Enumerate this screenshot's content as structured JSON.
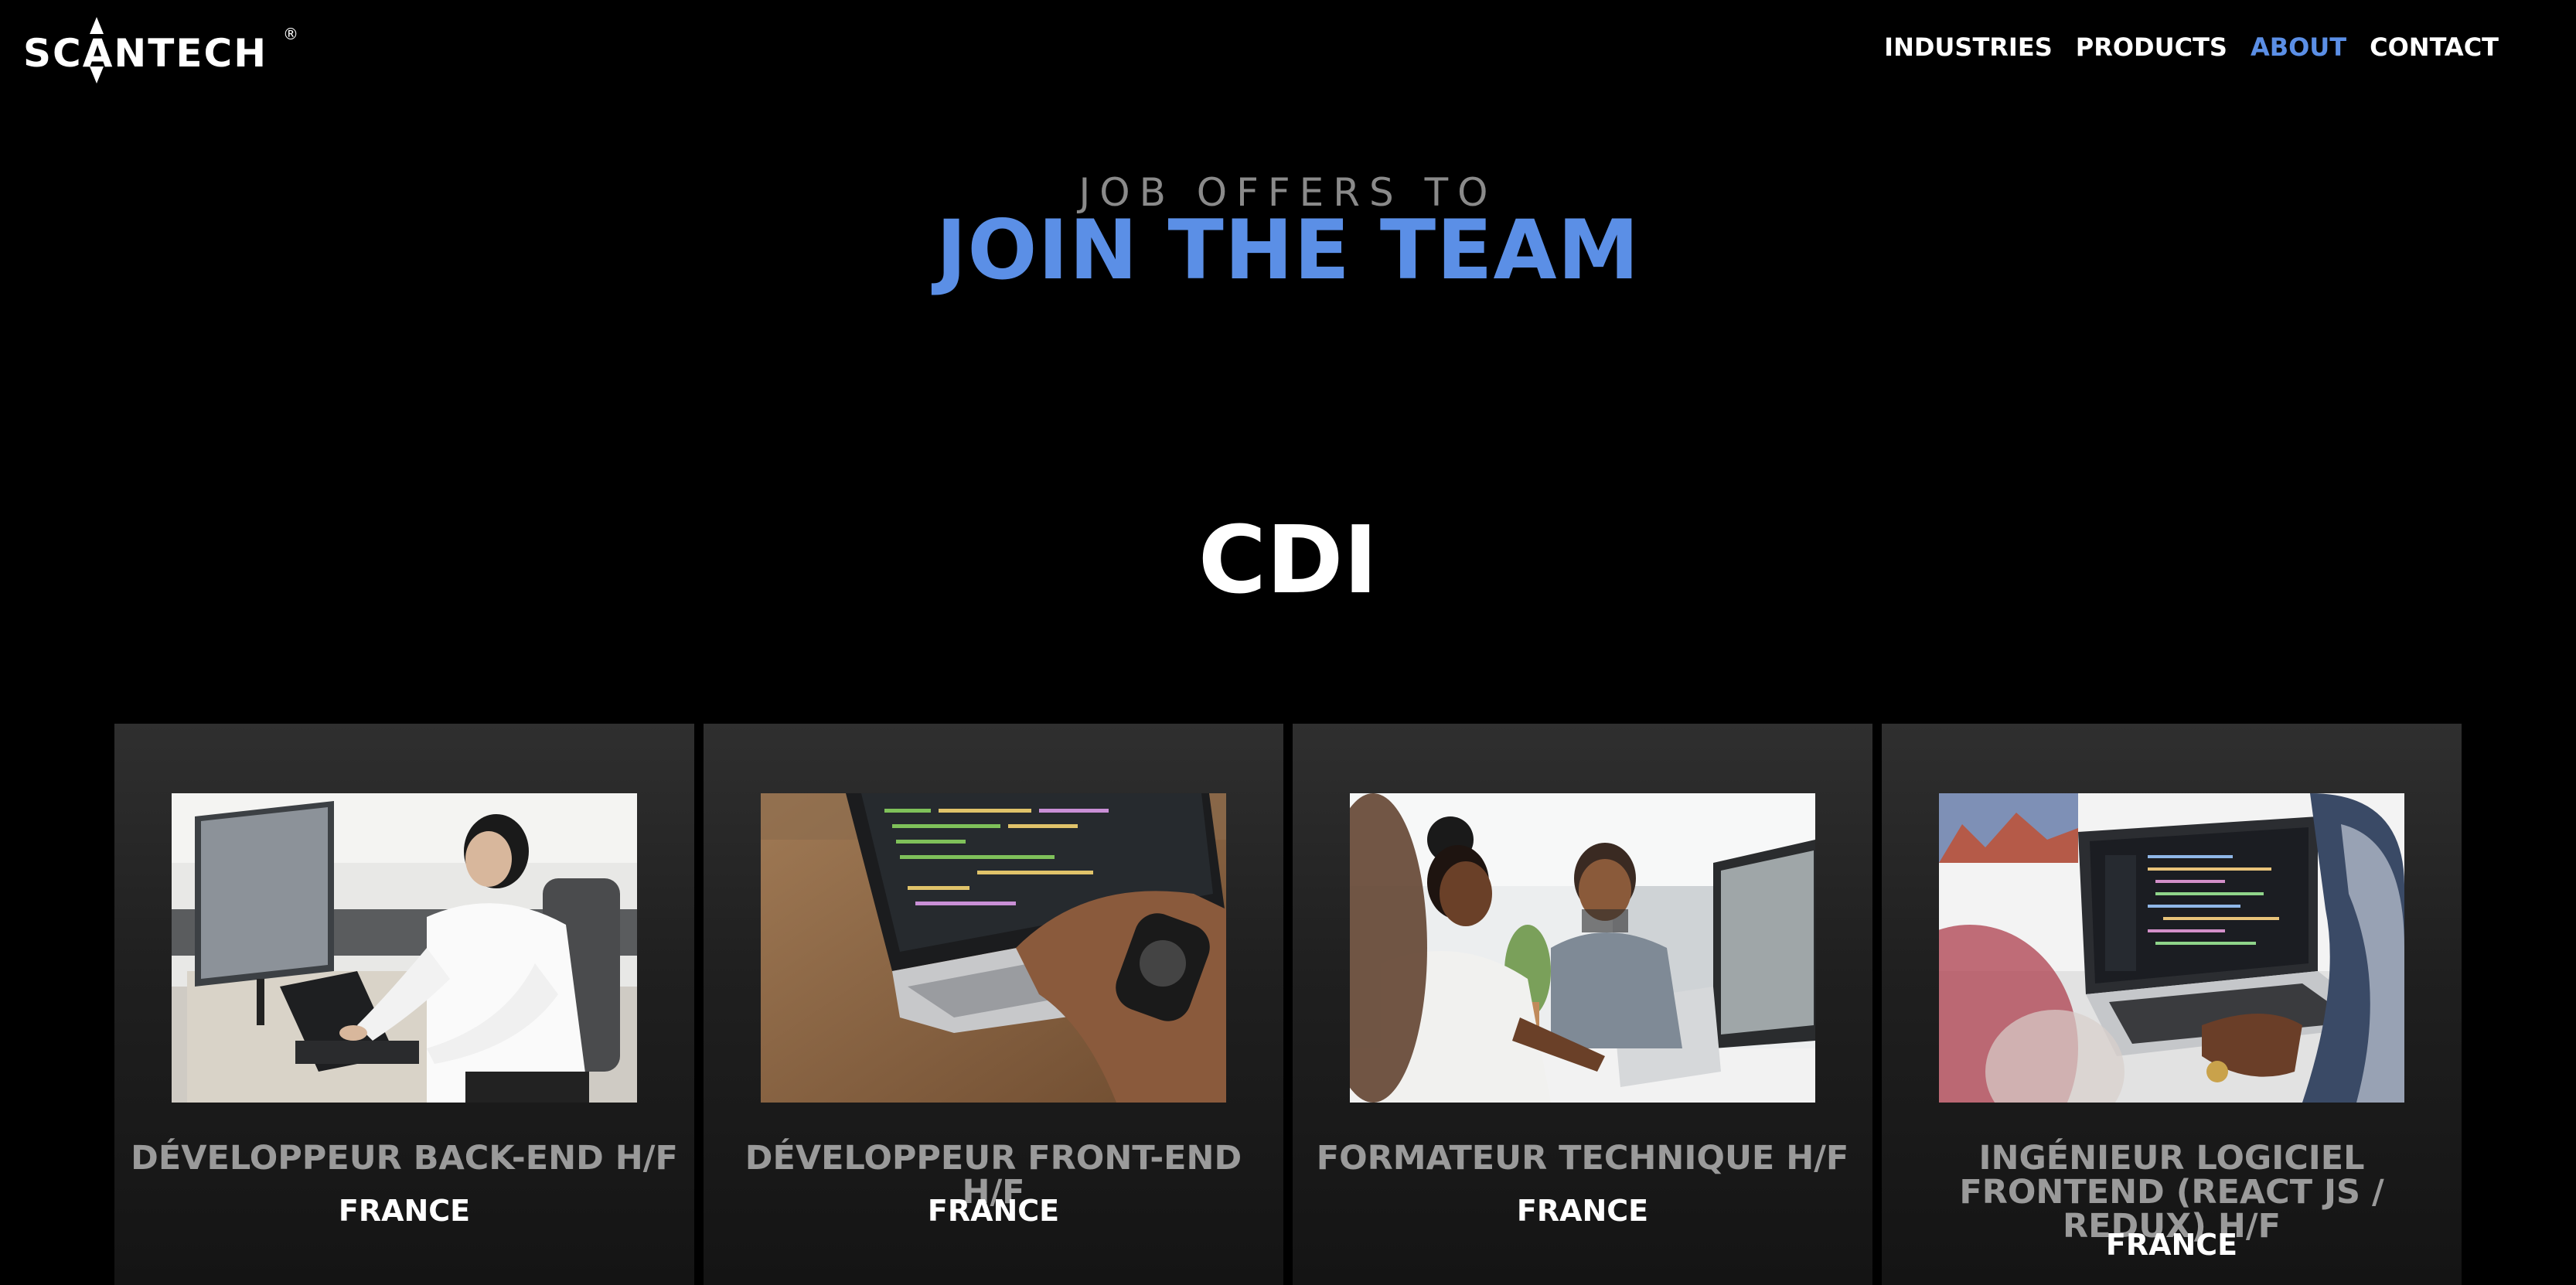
{
  "header": {
    "logo_text": "SCANTECH",
    "logo_mark": "®",
    "nav": [
      {
        "label": "INDUSTRIES",
        "active": false
      },
      {
        "label": "PRODUCTS",
        "active": false
      },
      {
        "label": "ABOUT",
        "active": true
      },
      {
        "label": "CONTACT",
        "active": false
      }
    ]
  },
  "hero": {
    "kicker": "JOB OFFERS TO",
    "title": "JOIN THE TEAM"
  },
  "section": {
    "title": "CDI"
  },
  "jobs": [
    {
      "title": "DÉVELOPPEUR BACK-END H/F",
      "location": "FRANCE",
      "image": "man-at-computer-photo"
    },
    {
      "title": "DÉVELOPPEUR FRONT-END H/F",
      "location": "FRANCE",
      "image": "hands-on-laptop-code-photo"
    },
    {
      "title": "FORMATEUR TECHNIQUE H/F",
      "location": "FRANCE",
      "image": "colleagues-at-desk-photo"
    },
    {
      "title": "INGÉNIEUR LOGICIEL FRONTEND (REACT JS / REDUX) H/F",
      "location": "FRANCE",
      "image": "laptop-with-code-photo"
    }
  ],
  "colors": {
    "background": "#000000",
    "accent": "#5b8fe6",
    "kicker": "#8a8a8a",
    "card_title": "#9a9a9a"
  }
}
